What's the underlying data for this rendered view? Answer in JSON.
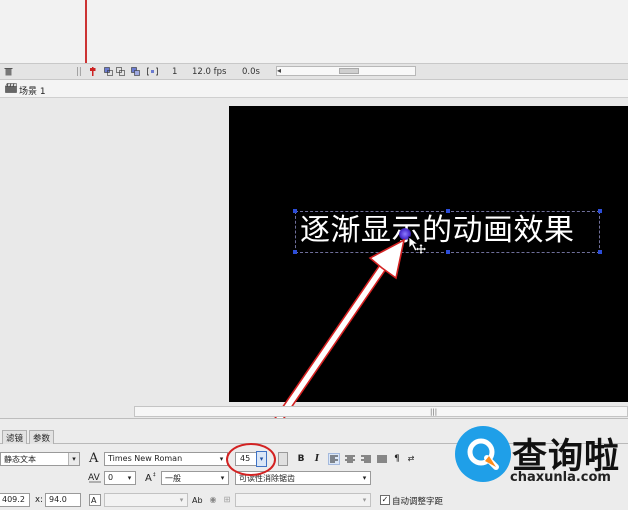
{
  "timeline": {
    "frame_number": "1",
    "fps": "12.0 fps",
    "elapsed": "0.0s",
    "scroll_left_glyph": "◂",
    "scroll_grip_glyph": "|||"
  },
  "scene": {
    "label": "场景 1"
  },
  "stage": {
    "text": "逐渐显示的动画效果"
  },
  "stage_scroll": {
    "grip_glyph": "|||"
  },
  "properties": {
    "tabs": [
      "滤镜",
      "参数"
    ],
    "text_type": "静态文本",
    "font_glyph": "A",
    "font_family": "Times New Roman",
    "font_size": "45",
    "bold_label": "B",
    "italic_label": "I",
    "letter_spacing": "0",
    "char_position": "一般",
    "antialias": "可读性消除锯齿",
    "width_value": "409.2",
    "x_label": "x:",
    "x_value": "94.0",
    "auto_kern_label": "自动调整字距"
  },
  "watermark": {
    "title": "查询啦",
    "url": "chaxunla.com",
    "brand_color": "#1f9fe8"
  },
  "colors": {
    "annotation_red": "#d32222",
    "stage_bg": "#000000",
    "selection_handle": "#2c4dd8"
  }
}
